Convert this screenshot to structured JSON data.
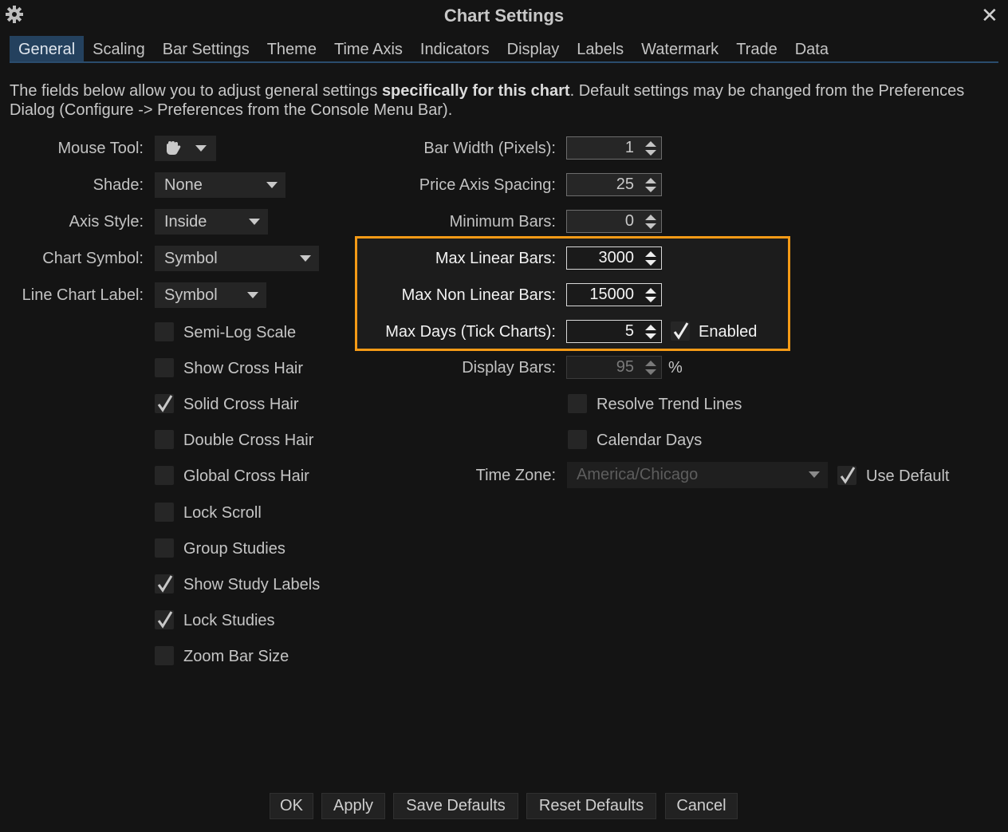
{
  "window": {
    "title": "Chart Settings",
    "gear_icon": "gear-icon",
    "close_glyph": "✕"
  },
  "tabs": [
    {
      "label": "General",
      "active": true
    },
    {
      "label": "Scaling"
    },
    {
      "label": "Bar Settings"
    },
    {
      "label": "Theme"
    },
    {
      "label": "Time Axis"
    },
    {
      "label": "Indicators"
    },
    {
      "label": "Display"
    },
    {
      "label": "Labels"
    },
    {
      "label": "Watermark"
    },
    {
      "label": "Trade"
    },
    {
      "label": "Data"
    }
  ],
  "description": {
    "pre": "The fields below allow you to adjust general settings ",
    "bold": "specifically for this chart",
    "post": ".  Default settings may be changed from the Preferences Dialog (Configure -> Preferences from the Console Menu Bar)."
  },
  "left": {
    "mouse_tool": {
      "label": "Mouse Tool:",
      "icon": "hand-icon"
    },
    "shade": {
      "label": "Shade:",
      "value": "None"
    },
    "axis_style": {
      "label": "Axis Style:",
      "value": "Inside"
    },
    "chart_symbol": {
      "label": "Chart Symbol:",
      "value": "Symbol"
    },
    "line_chart_label": {
      "label": "Line Chart Label:",
      "value": "Symbol"
    },
    "checkboxes": [
      {
        "label": "Semi-Log Scale",
        "checked": false
      },
      {
        "label": "Show Cross Hair",
        "checked": false
      },
      {
        "label": "Solid Cross Hair",
        "checked": true
      },
      {
        "label": "Double Cross Hair",
        "checked": false
      },
      {
        "label": "Global Cross Hair",
        "checked": false
      },
      {
        "label": "Lock Scroll",
        "checked": false
      },
      {
        "label": "Group Studies",
        "checked": false
      },
      {
        "label": "Show Study Labels",
        "checked": true
      },
      {
        "label": "Lock Studies",
        "checked": true
      },
      {
        "label": "Zoom Bar Size",
        "checked": false
      }
    ]
  },
  "right": {
    "bar_width": {
      "label": "Bar Width (Pixels):",
      "value": "1"
    },
    "price_axis_spacing": {
      "label": "Price Axis Spacing:",
      "value": "25"
    },
    "minimum_bars": {
      "label": "Minimum Bars:",
      "value": "0"
    },
    "max_linear_bars": {
      "label": "Max Linear Bars:",
      "value": "3000"
    },
    "max_non_linear_bars": {
      "label": "Max Non Linear Bars:",
      "value": "15000"
    },
    "max_days": {
      "label": "Max Days (Tick Charts):",
      "value": "5",
      "enabled_label": "Enabled",
      "enabled": true
    },
    "display_bars": {
      "label": "Display Bars:",
      "value": "95",
      "unit": "%"
    },
    "resolve_trend_lines": {
      "label": "Resolve Trend Lines",
      "checked": false
    },
    "calendar_days": {
      "label": "Calendar Days",
      "checked": false
    },
    "time_zone": {
      "label": "Time Zone:",
      "value": "America/Chicago",
      "use_default_label": "Use Default",
      "use_default": true
    }
  },
  "footer": {
    "ok": "OK",
    "apply": "Apply",
    "save_defaults": "Save Defaults",
    "reset_defaults": "Reset Defaults",
    "cancel": "Cancel"
  },
  "colors": {
    "highlight": "#f49a16",
    "active_tab": "#24415e",
    "background": "#141414"
  }
}
